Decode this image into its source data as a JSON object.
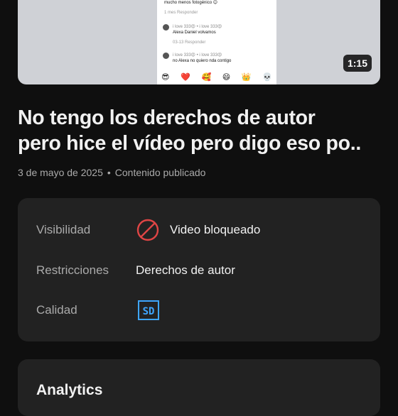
{
  "video": {
    "duration": "1:15",
    "preview": {
      "comment0_text": "mucho menos fotogénico 😊",
      "comment0_meta": "1 mes   Responder",
      "comment1_author": "i love 333😍 • i love 333😍",
      "comment1_text": "Alexa Daniel volvamos",
      "comment1_meta": "03-13   Responder",
      "comment2_author": "i love 333😍 • i love 333😍",
      "comment2_text": "no Alexa no quiero nda contigo",
      "emojis": [
        "😎",
        "❤️",
        "🥰",
        "😄",
        "👑",
        "💀"
      ]
    }
  },
  "title_line1": "No tengo los derechos de autor",
  "title_line2": "pero hice el vídeo pero digo eso po..",
  "date": "3 de mayo de 2025",
  "status": "Contenido publicado",
  "details": {
    "visibility_label": "Visibilidad",
    "visibility_value": "Video bloqueado",
    "restrictions_label": "Restricciones",
    "restrictions_value": "Derechos de autor",
    "quality_label": "Calidad",
    "quality_value": "SD"
  },
  "analytics_heading": "Analytics",
  "colors": {
    "blocked": "#e04545",
    "sd_badge": "#3ea6ff"
  }
}
